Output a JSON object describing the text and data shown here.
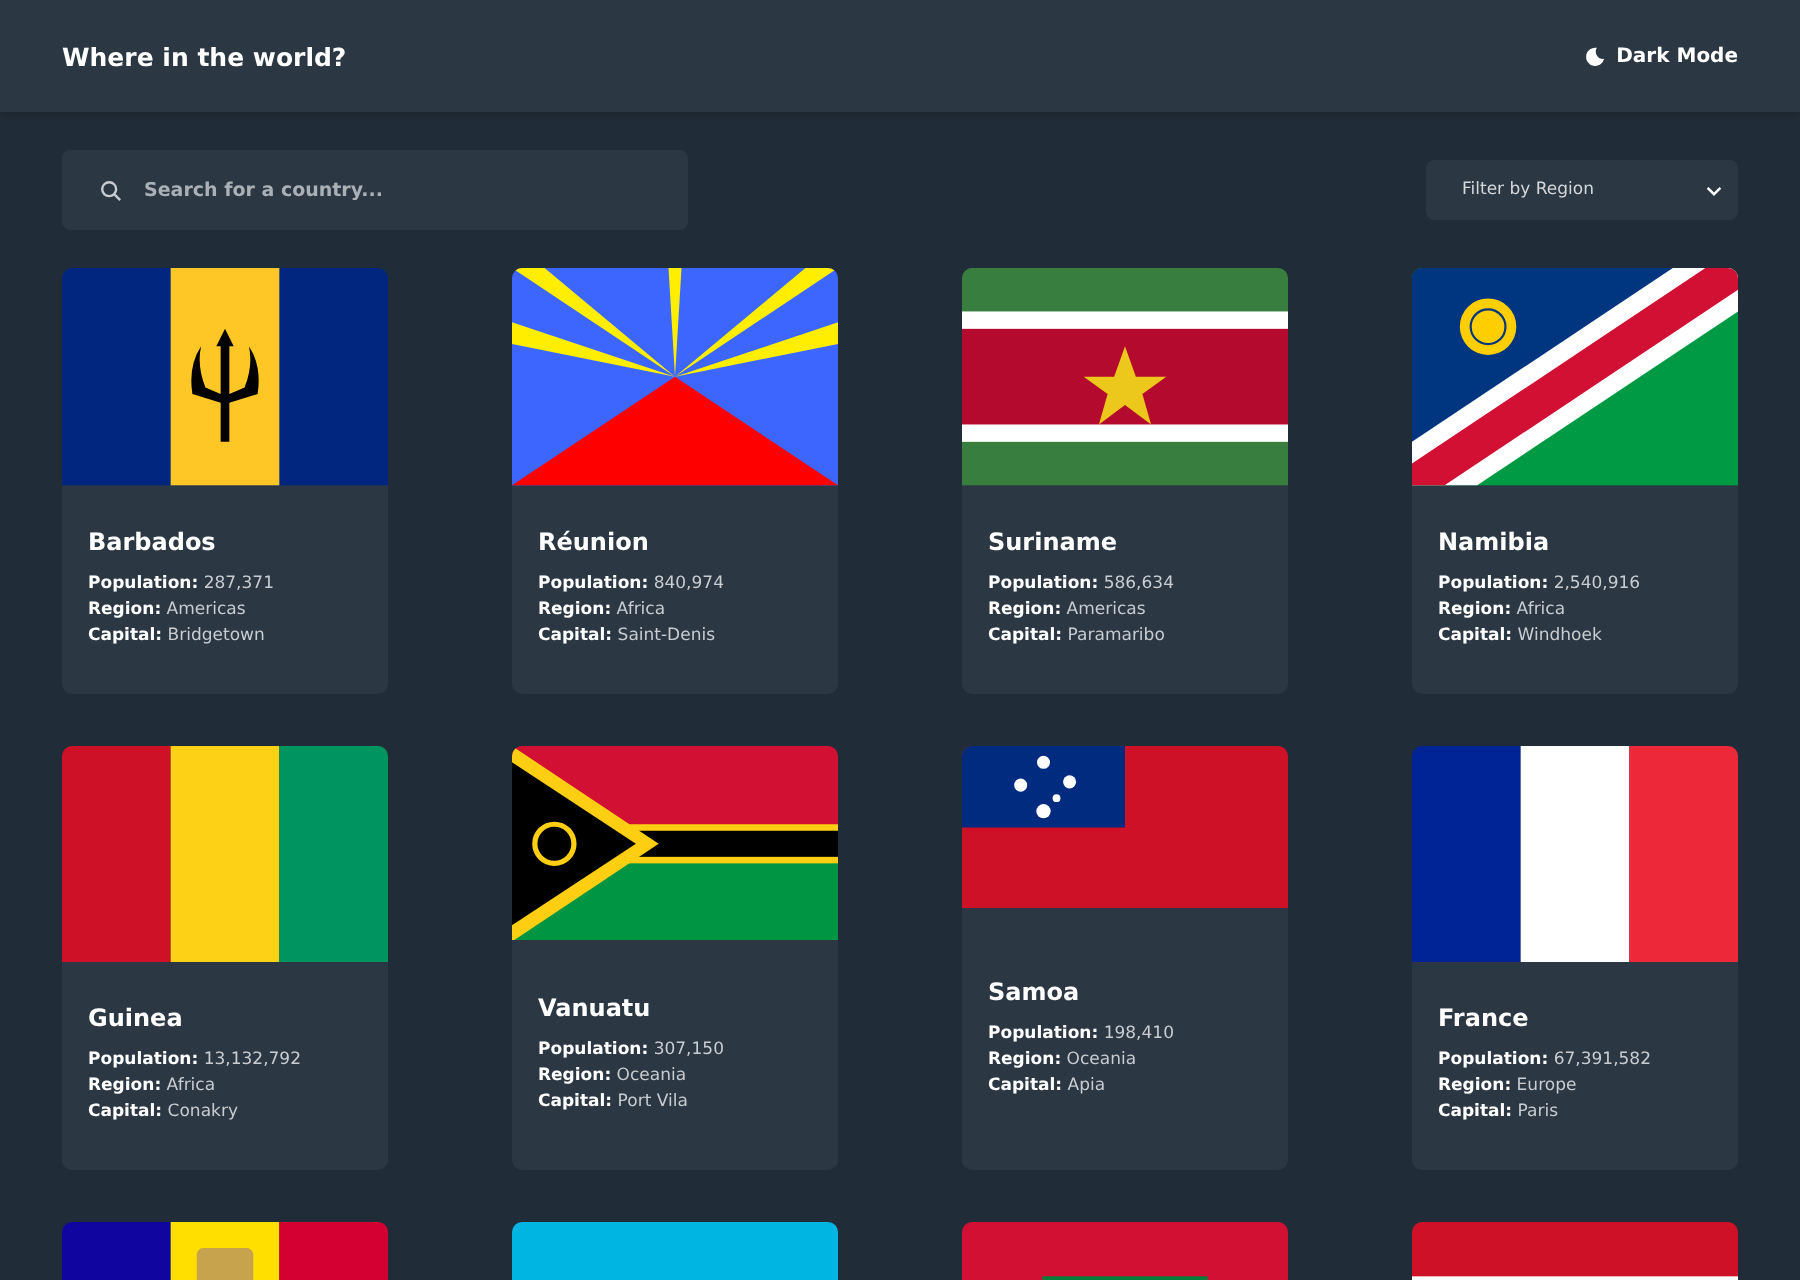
{
  "header": {
    "title": "Where in the world?",
    "theme_toggle": "Dark Mode"
  },
  "search": {
    "placeholder": "Search for a country..."
  },
  "filter": {
    "placeholder": "Filter by Region"
  },
  "countries": [
    {
      "kind": "barbados",
      "name": "Barbados",
      "fields": [
        {
          "label": "Population:",
          "value": "287,371"
        },
        {
          "label": "Region:",
          "value": "Americas"
        },
        {
          "label": "Capital:",
          "value": "Bridgetown"
        }
      ]
    },
    {
      "kind": "reunion",
      "name": "Réunion",
      "fields": [
        {
          "label": "Population:",
          "value": "840,974"
        },
        {
          "label": "Region:",
          "value": "Africa"
        },
        {
          "label": "Capital:",
          "value": "Saint-Denis"
        }
      ]
    },
    {
      "kind": "suriname",
      "name": "Suriname",
      "fields": [
        {
          "label": "Population:",
          "value": "586,634"
        },
        {
          "label": "Region:",
          "value": "Americas"
        },
        {
          "label": "Capital:",
          "value": "Paramaribo"
        }
      ]
    },
    {
      "kind": "namibia",
      "name": "Namibia",
      "fields": [
        {
          "label": "Population:",
          "value": "2,540,916"
        },
        {
          "label": "Region:",
          "value": "Africa"
        },
        {
          "label": "Capital:",
          "value": "Windhoek"
        }
      ]
    },
    {
      "kind": "guinea",
      "name": "Guinea",
      "fields": [
        {
          "label": "Population:",
          "value": "13,132,792"
        },
        {
          "label": "Region:",
          "value": "Africa"
        },
        {
          "label": "Capital:",
          "value": "Conakry"
        }
      ]
    },
    {
      "kind": "vanuatu",
      "name": "Vanuatu",
      "fields": [
        {
          "label": "Population:",
          "value": "307,150"
        },
        {
          "label": "Region:",
          "value": "Oceania"
        },
        {
          "label": "Capital:",
          "value": "Port Vila"
        }
      ]
    },
    {
      "kind": "samoa",
      "name": "Samoa",
      "fields": [
        {
          "label": "Population:",
          "value": "198,410"
        },
        {
          "label": "Region:",
          "value": "Oceania"
        },
        {
          "label": "Capital:",
          "value": "Apia"
        }
      ]
    },
    {
      "kind": "france",
      "name": "France",
      "fields": [
        {
          "label": "Population:",
          "value": "67,391,582"
        },
        {
          "label": "Region:",
          "value": "Europe"
        },
        {
          "label": "Capital:",
          "value": "Paris"
        }
      ]
    },
    {
      "kind": "andorra"
    },
    {
      "kind": "azerbaijan"
    },
    {
      "kind": "maldives"
    },
    {
      "kind": "polynesia"
    }
  ]
}
